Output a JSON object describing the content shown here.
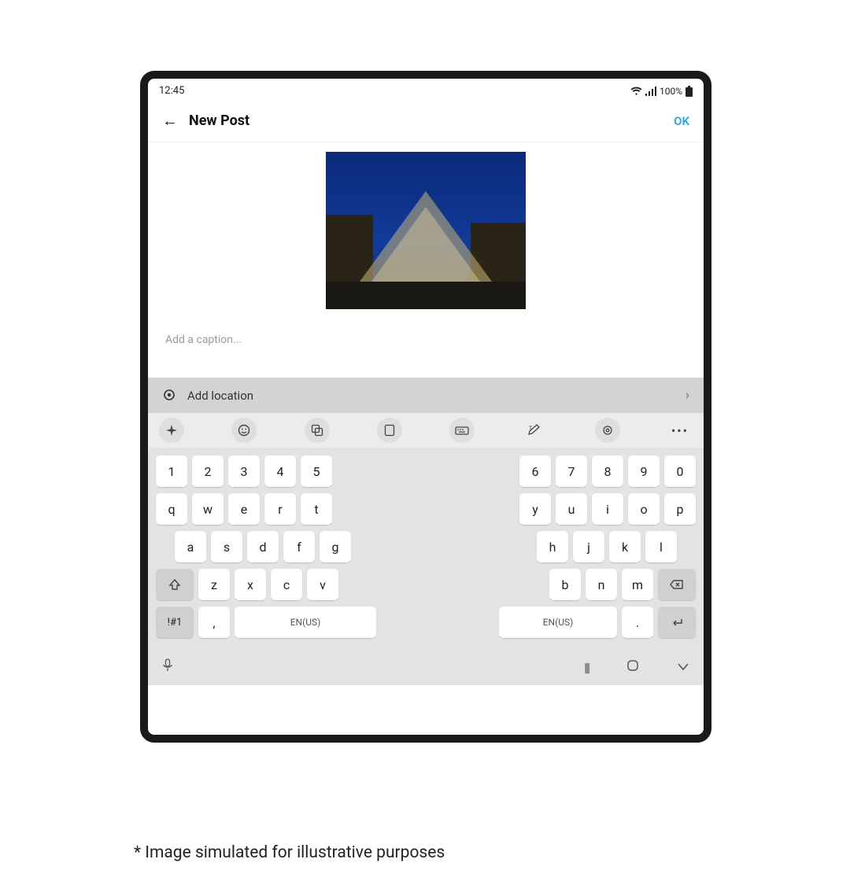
{
  "status": {
    "time": "12:45",
    "battery": "100%"
  },
  "header": {
    "title": "New Post",
    "ok": "OK"
  },
  "caption": {
    "placeholder": "Add a caption..."
  },
  "location": {
    "label": "Add location"
  },
  "keyboard": {
    "row1_left": [
      "1",
      "2",
      "3",
      "4",
      "5"
    ],
    "row1_right": [
      "6",
      "7",
      "8",
      "9",
      "0"
    ],
    "row2_left": [
      "q",
      "w",
      "e",
      "r",
      "t"
    ],
    "row2_right": [
      "y",
      "u",
      "i",
      "o",
      "p"
    ],
    "row3_left": [
      "a",
      "s",
      "d",
      "f",
      "g"
    ],
    "row3_right": [
      "h",
      "j",
      "k",
      "l"
    ],
    "row4_left": [
      "z",
      "x",
      "c",
      "v"
    ],
    "row4_right": [
      "b",
      "n",
      "m"
    ],
    "sym": "!#1",
    "comma": ",",
    "space": "EN(US)",
    "period": "."
  },
  "footnote": "* Image simulated for illustrative purposes"
}
